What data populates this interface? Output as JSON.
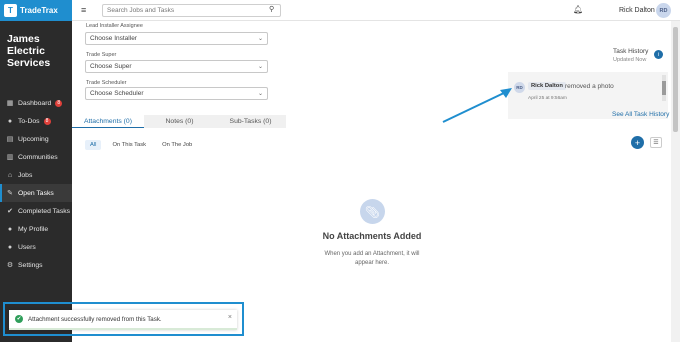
{
  "brand": {
    "name": "TradeTrax",
    "logo_text": "T"
  },
  "company": {
    "name_line1": "James",
    "name_line2": "Electric",
    "name_line3": "Services"
  },
  "sidebar": {
    "items": [
      {
        "label": "Dashboard",
        "icon": "dashboard-icon",
        "badge": "8"
      },
      {
        "label": "To-Dos",
        "icon": "alert-circle-icon",
        "badge": "8"
      },
      {
        "label": "Upcoming",
        "icon": "calendar-icon"
      },
      {
        "label": "Communities",
        "icon": "building-icon"
      },
      {
        "label": "Jobs",
        "icon": "home-icon"
      },
      {
        "label": "Open Tasks",
        "icon": "wrench-icon",
        "active": true
      },
      {
        "label": "Completed Tasks",
        "icon": "check-circle-icon"
      },
      {
        "label": "My Profile",
        "icon": "user-icon"
      },
      {
        "label": "Users",
        "icon": "users-icon"
      },
      {
        "label": "Settings",
        "icon": "gear-icon"
      }
    ]
  },
  "topbar": {
    "search_placeholder": "Search Jobs and Tasks",
    "user_name": "Rick Dalton",
    "avatar_initials": "RD"
  },
  "form": {
    "installer_label": "Lead Installer Assignee",
    "installer_value": "Choose Installer",
    "super_label": "Trade Super",
    "super_value": "Choose Super",
    "scheduler_label": "Trade Scheduler",
    "scheduler_value": "Choose Scheduler"
  },
  "tabs": [
    {
      "label": "Attachments (0)",
      "active": true
    },
    {
      "label": "Notes (0)"
    },
    {
      "label": "Sub-Tasks (0)"
    }
  ],
  "filters": [
    "All",
    "On This Task",
    "On The Job"
  ],
  "empty_state": {
    "title": "No Attachments Added",
    "subtitle_line1": "When you add an Attachment, it will",
    "subtitle_line2": "appear here."
  },
  "task_history": {
    "title": "Task History",
    "subtitle": "Updated Now",
    "entry_initials": "RD",
    "entry_user": "Rick Dalton",
    "entry_action": "removed a photo",
    "entry_time": "April 25 at 9:56am",
    "see_all": "See All Task History"
  },
  "toast": {
    "message": "Attachment successfully removed from this Task.",
    "close": "×"
  },
  "colors": {
    "accent": "#1f6ea8",
    "brand": "#1f8ecf",
    "sidebar": "#2b2b2b",
    "success": "#2f9e5a",
    "annotation": "#1f8ecf"
  }
}
